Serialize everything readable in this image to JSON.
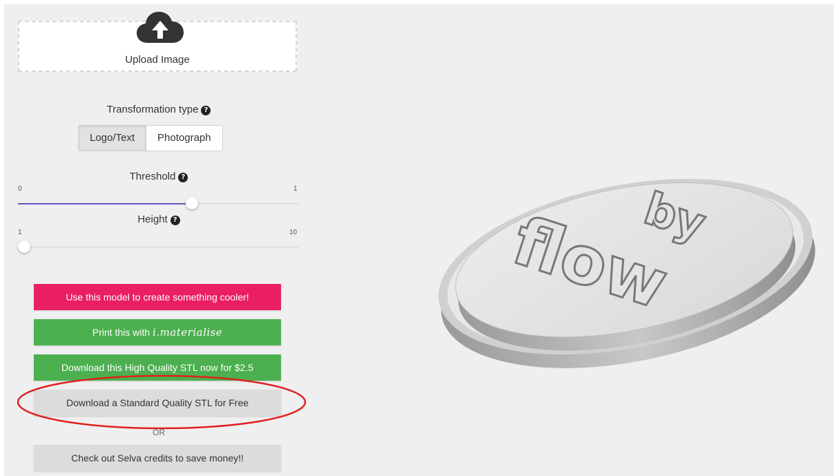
{
  "upload": {
    "label": "Upload Image",
    "icon": "cloud-upload-icon"
  },
  "transformation": {
    "title": "Transformation type",
    "options": [
      "Logo/Text",
      "Photograph"
    ],
    "selected": "Logo/Text"
  },
  "threshold": {
    "title": "Threshold",
    "min": "0",
    "max": "1",
    "value": 0.62
  },
  "height": {
    "title": "Height",
    "min": "1",
    "max": "10",
    "value": 1
  },
  "buttons": {
    "create": "Use this model to create something cooler!",
    "print_prefix": "Print this with",
    "print_brand": "i.materialise",
    "download_hq": "Download this High Quality STL now for $2.5",
    "download_std": "Download a Standard Quality STL for Free",
    "or": "OR",
    "credits": "Check out Selva credits to save money!!"
  },
  "preview": {
    "text_top": "by",
    "text_bottom": "flow"
  },
  "colors": {
    "pink": "#e91e63",
    "green": "#4caf50",
    "slider": "#6a4fc0",
    "annotation": "#e02020"
  }
}
